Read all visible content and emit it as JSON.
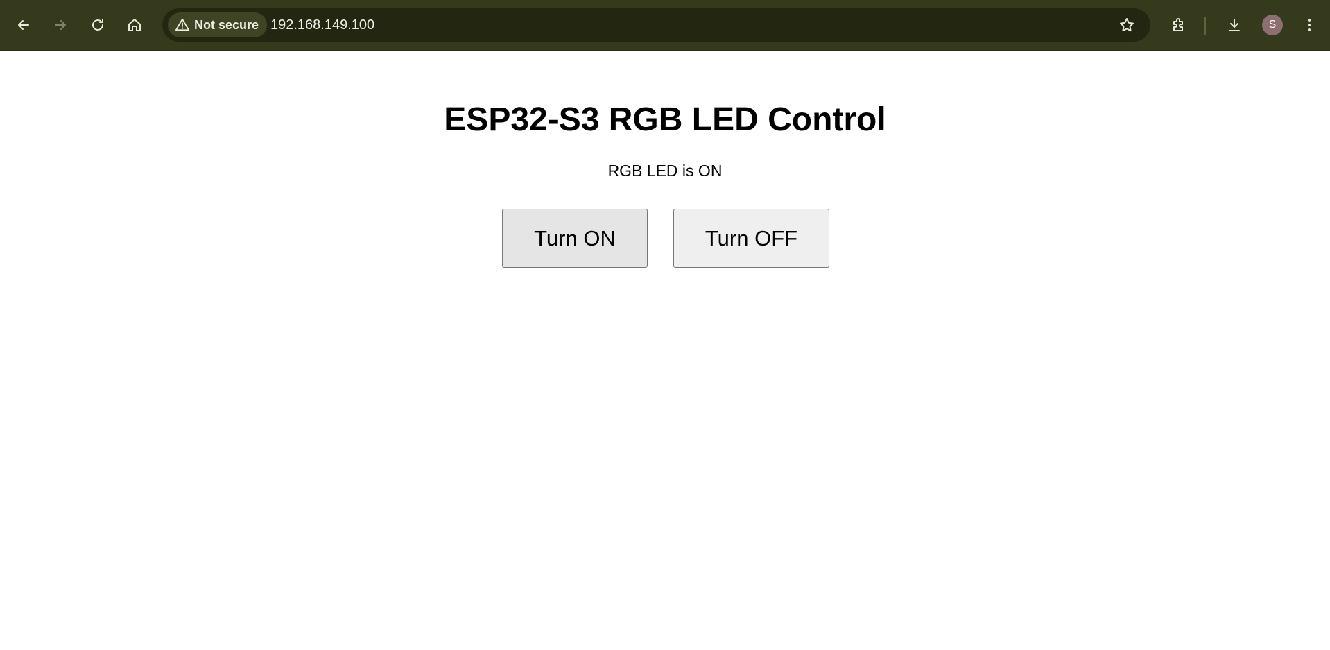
{
  "browser": {
    "security_label": "Not secure",
    "url": "192.168.149.100",
    "profile_initial": "S",
    "icons": {
      "back": "back-arrow-icon",
      "forward": "forward-arrow-icon",
      "reload": "reload-icon",
      "home": "home-icon",
      "warning": "warning-triangle-icon",
      "bookmark": "star-icon",
      "extensions": "puzzle-icon",
      "downloads": "download-icon",
      "menu": "kebab-menu-icon"
    },
    "colors": {
      "toolbar": "#353a1d",
      "omnibox": "#232711",
      "avatar": "#8d6f72"
    }
  },
  "page": {
    "title": "ESP32-S3 RGB LED Control",
    "status": "RGB LED is ON",
    "buttons": {
      "on_label": "Turn ON",
      "off_label": "Turn OFF"
    }
  }
}
